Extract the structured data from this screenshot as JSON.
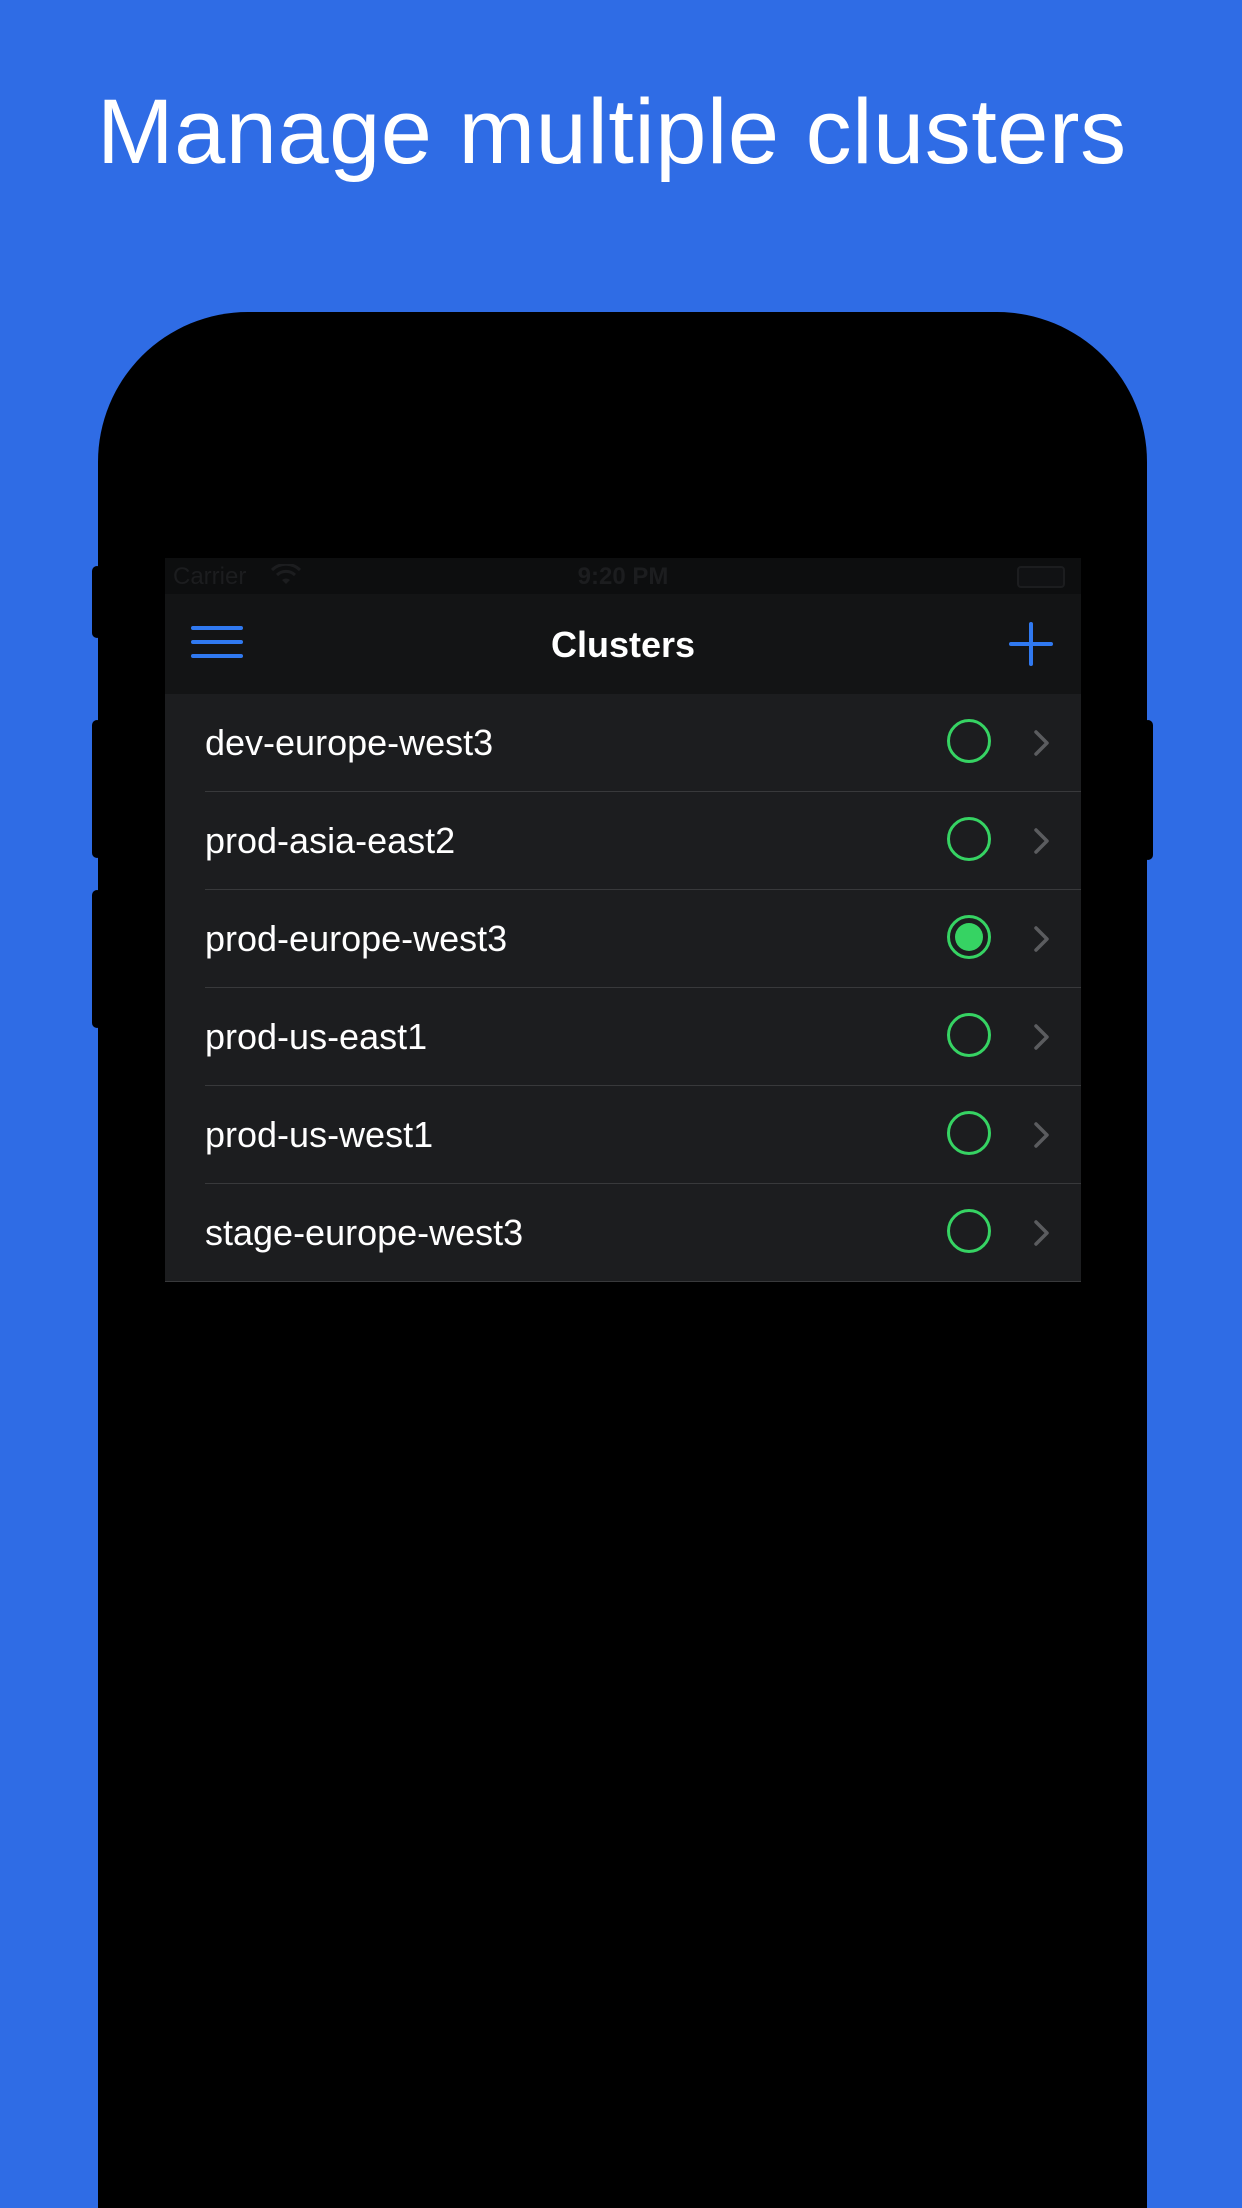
{
  "headline": "Manage multiple clusters",
  "status_bar": {
    "carrier": "Carrier",
    "time": "9:20 PM"
  },
  "nav": {
    "title": "Clusters",
    "menu_icon": "hamburger-icon",
    "add_icon": "plus-icon"
  },
  "colors": {
    "background": "#2f6ce5",
    "accent": "#3079f0",
    "status_green": "#36d363"
  },
  "clusters": [
    {
      "name": "dev-europe-west3",
      "active": false
    },
    {
      "name": "prod-asia-east2",
      "active": false
    },
    {
      "name": "prod-europe-west3",
      "active": true
    },
    {
      "name": "prod-us-east1",
      "active": false
    },
    {
      "name": "prod-us-west1",
      "active": false
    },
    {
      "name": "stage-europe-west3",
      "active": false
    }
  ]
}
